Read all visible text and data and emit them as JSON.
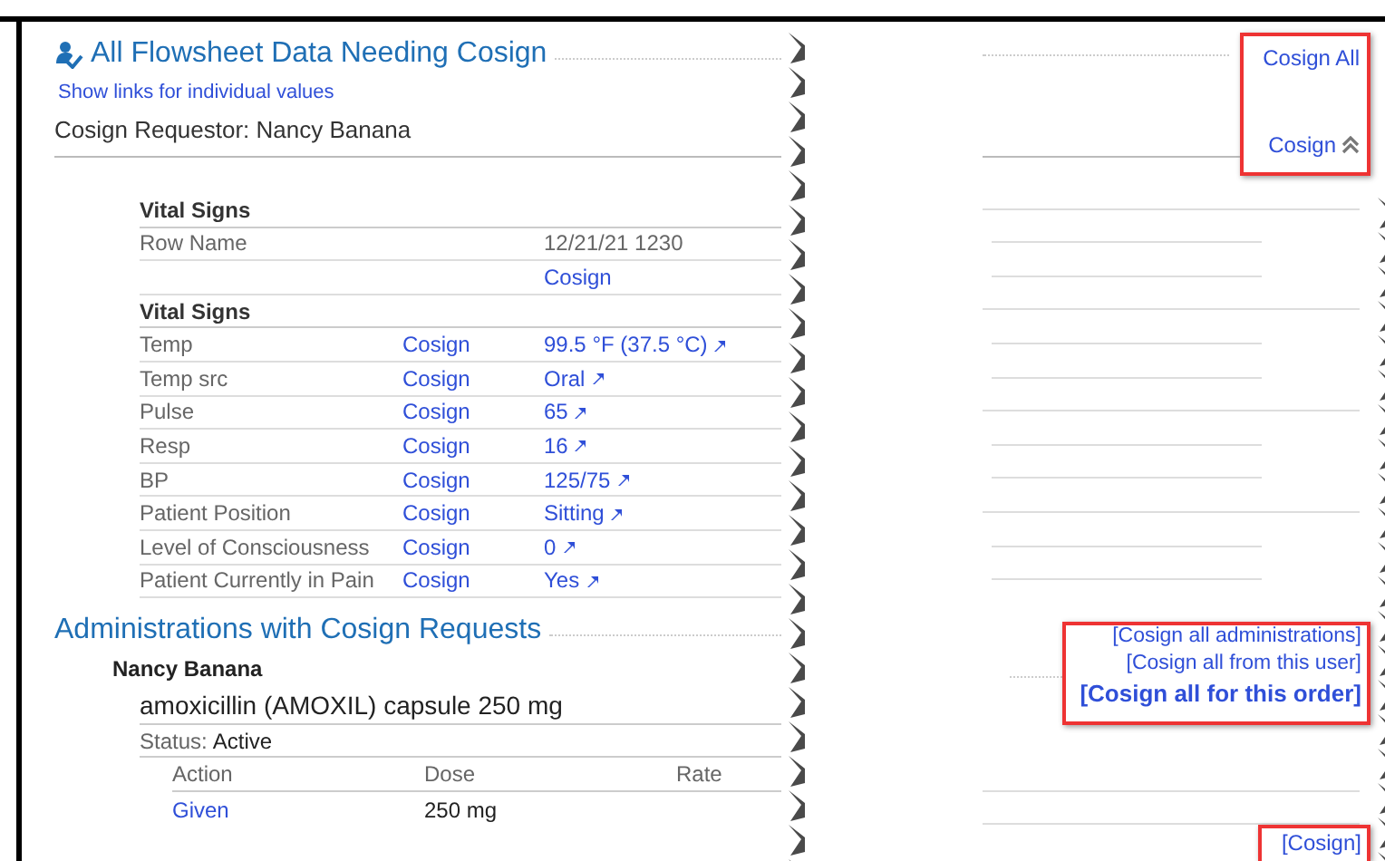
{
  "flowsheet": {
    "title": "All Flowsheet Data Needing Cosign",
    "show_links": "Show links for individual values",
    "requestor": "Cosign Requestor: Nancy Banana",
    "cosign_all": "Cosign All",
    "cosign": "Cosign",
    "header_group": {
      "name": "Vital Signs",
      "column_label": "Row Name",
      "time": "12/21/21 1230",
      "action": "Cosign"
    },
    "group": {
      "name": "Vital Signs",
      "rows": [
        {
          "name": "Temp",
          "action": "Cosign",
          "value": "99.5 °F (37.5 °C)"
        },
        {
          "name": "Temp src",
          "action": "Cosign",
          "value": "Oral"
        },
        {
          "name": "Pulse",
          "action": "Cosign",
          "value": "65"
        },
        {
          "name": "Resp",
          "action": "Cosign",
          "value": "16"
        },
        {
          "name": "BP",
          "action": "Cosign",
          "value": "125/75"
        },
        {
          "name": "Patient Position",
          "action": "Cosign",
          "value": "Sitting"
        },
        {
          "name": "Level of Consciousness",
          "action": "Cosign",
          "value": "0"
        },
        {
          "name": "Patient Currently in Pain",
          "action": "Cosign",
          "value": "Yes"
        }
      ]
    }
  },
  "administrations": {
    "title": "Administrations with Cosign Requests",
    "user": "Nancy Banana",
    "order": "amoxicillin (AMOXIL) capsule 250 mg",
    "status_label": "Status:",
    "status": "Active",
    "columns": [
      "Action",
      "Dose",
      "Rate"
    ],
    "rows": [
      {
        "action": "Given",
        "dose": "250 mg"
      }
    ],
    "links": [
      {
        "text": "[Cosign all administrations]",
        "emphasis": false
      },
      {
        "text": "[Cosign all from this user]",
        "emphasis": false
      },
      {
        "text": "[Cosign all for this order]",
        "emphasis": true
      }
    ],
    "row_link": "[Cosign]"
  }
}
